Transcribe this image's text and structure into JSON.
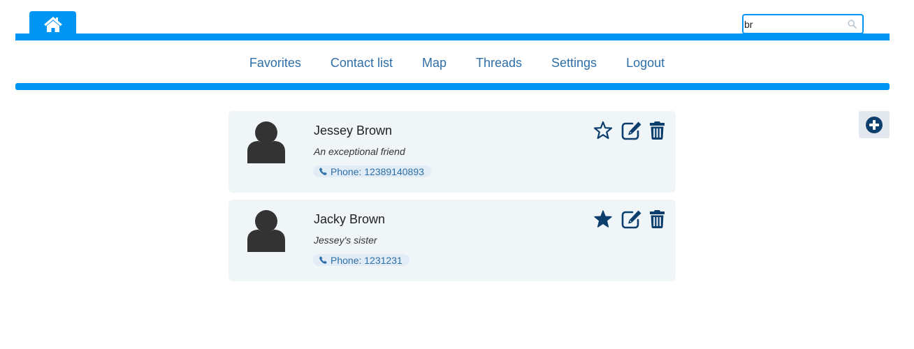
{
  "header": {
    "home_icon": "home-icon",
    "search": {
      "value": "br",
      "placeholder": "",
      "icon": "search-icon"
    }
  },
  "nav": {
    "items": [
      {
        "label": "Favorites"
      },
      {
        "label": "Contact list"
      },
      {
        "label": "Map"
      },
      {
        "label": "Threads"
      },
      {
        "label": "Settings"
      },
      {
        "label": "Logout"
      }
    ]
  },
  "add_button": {
    "icon": "plus-circle-icon"
  },
  "contacts": [
    {
      "name": "Jessey Brown",
      "description": "An exceptional friend",
      "phone": "Phone: 12389140893",
      "favorite": false
    },
    {
      "name": "Jacky Brown",
      "description": "Jessey's sister",
      "phone": "Phone: 1231231",
      "favorite": true
    }
  ],
  "colors": {
    "accent_blue": "#0095f2",
    "link_blue": "#2f6fa7",
    "icon_navy": "#0c3e6e",
    "card_bg": "#f0f5f8",
    "avatar_dark": "#333333"
  }
}
